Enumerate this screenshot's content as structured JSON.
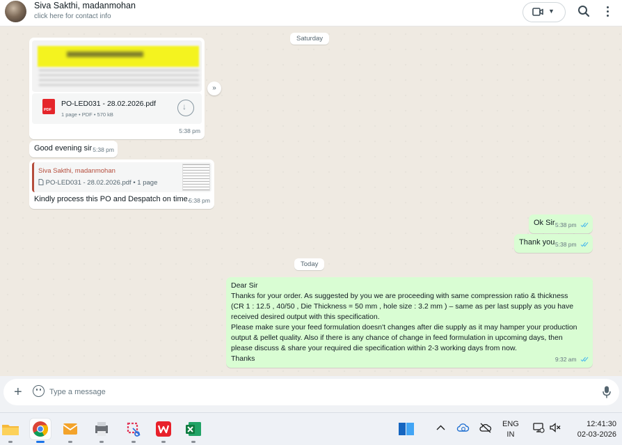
{
  "header": {
    "contact_name": "Siva Sakthi, madanmohan",
    "contact_sub": "click here for contact info"
  },
  "chips": {
    "saturday": "Saturday",
    "today": "Today"
  },
  "messages": {
    "doc": {
      "file_name": "PO-LED031 - 28.02.2026.pdf",
      "file_meta": "1 page • PDF • 570 kB",
      "pdf_badge": "PDF",
      "time": "5:38 pm"
    },
    "greeting": {
      "text": "Good evening sir",
      "time": "5:38 pm"
    },
    "reply": {
      "quote_author": "Siva Sakthi, madanmohan",
      "quote_text": "PO-LED031 - 28.02.2026.pdf • 1 page",
      "text": "Kindly process this PO and Despatch on time.",
      "time": "5:38 pm"
    },
    "ok": {
      "text": "Ok Sir",
      "time": "5:38 pm"
    },
    "thanks": {
      "text": "Thank you",
      "time": "5:38 pm"
    },
    "long": {
      "lines": [
        "Dear Sir",
        "Thanks for your order. As suggested by you we are proceeding with same compression ratio & thickness",
        "(CR 1 : 12.5 , 40/50 , Die Thickness = 50 mm , hole size : 3.2 mm  ) – same as per last supply as you have",
        "received desired output with this specification.",
        "Please make sure your feed formulation doesn't changes after die supply as it may hamper your production",
        "output & pellet quality. Also if there is any chance of change in feed formulation in upcoming days, then",
        "please discuss & share your required die specification within 2-3 working days from now.",
        "Thanks"
      ],
      "time": "9:32 am"
    }
  },
  "composer": {
    "placeholder": "Type a message"
  },
  "taskbar": {
    "lang_top": "ENG",
    "lang_bottom": "IN",
    "time": "12:41:30",
    "date": "02-03-2026"
  },
  "colors": {
    "incoming": "#ffffff",
    "outgoing": "#d9fdd3",
    "read_tick": "#53bdeb",
    "quote_accent": "#b54d3c"
  }
}
